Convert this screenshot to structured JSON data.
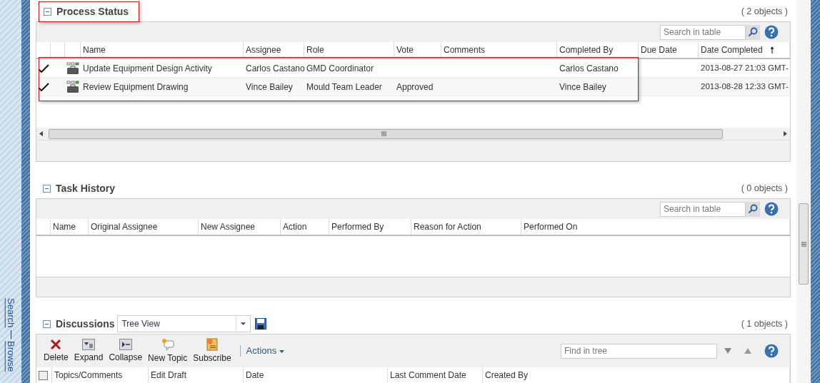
{
  "side_links": [
    "Search",
    "Browse"
  ],
  "process_status": {
    "title": "Process Status",
    "count": "( 2 objects )",
    "search": {
      "placeholder": "Search in table"
    },
    "columns": [
      {},
      {},
      {},
      {
        "label": "Name"
      },
      {
        "label": "Assignee"
      },
      {
        "label": "Role"
      },
      {
        "label": "Vote"
      },
      {
        "label": "Comments"
      },
      {
        "label": "Completed By"
      },
      {
        "label": "Due Date"
      },
      {
        "label": "Date Completed",
        "sorted": true
      }
    ],
    "rows": [
      {
        "done": true,
        "name": "Update Equipment Design Activity",
        "assignee": "Carlos Castano",
        "role": "GMD Coordinator",
        "vote": "",
        "completed_by": "Carlos Castano",
        "date_completed": "2013-08-27 21:03 GMT-"
      },
      {
        "done": true,
        "name": "Review Equipment Drawing",
        "assignee": "Vince Bailey",
        "role": "Mould Team Leader",
        "vote": "Approved",
        "completed_by": "Vince Bailey",
        "date_completed": "2013-08-28 12:33 GMT-"
      }
    ]
  },
  "task_history": {
    "title": "Task History",
    "count": "( 0 objects )",
    "search": {
      "placeholder": "Search in table"
    },
    "columns": [
      {},
      {
        "label": "Name"
      },
      {
        "label": "Original Assignee"
      },
      {
        "label": "New Assignee"
      },
      {
        "label": "Action"
      },
      {
        "label": "Performed By"
      },
      {
        "label": "Reason for Action"
      },
      {
        "label": "Performed On"
      }
    ]
  },
  "discussions": {
    "title": "Discussions",
    "view": "Tree View",
    "count": "( 1 objects )",
    "toolbar": [
      {
        "label": "Delete",
        "kind": "delete"
      },
      {
        "label": "Expand",
        "kind": "expand"
      },
      {
        "label": "Collapse",
        "kind": "collapse"
      },
      {
        "label": "New Topic",
        "kind": "new"
      },
      {
        "label": "Subscribe",
        "kind": "subscribe"
      }
    ],
    "actions": "Actions",
    "find": {
      "placeholder": "Find in tree"
    },
    "columns": [
      {
        "label": "Topics/Comments"
      },
      {
        "label": "Edit Draft"
      },
      {
        "label": "Date"
      },
      {
        "label": "Last Comment Date"
      },
      {
        "label": "Created By"
      }
    ],
    "select_all": false
  }
}
